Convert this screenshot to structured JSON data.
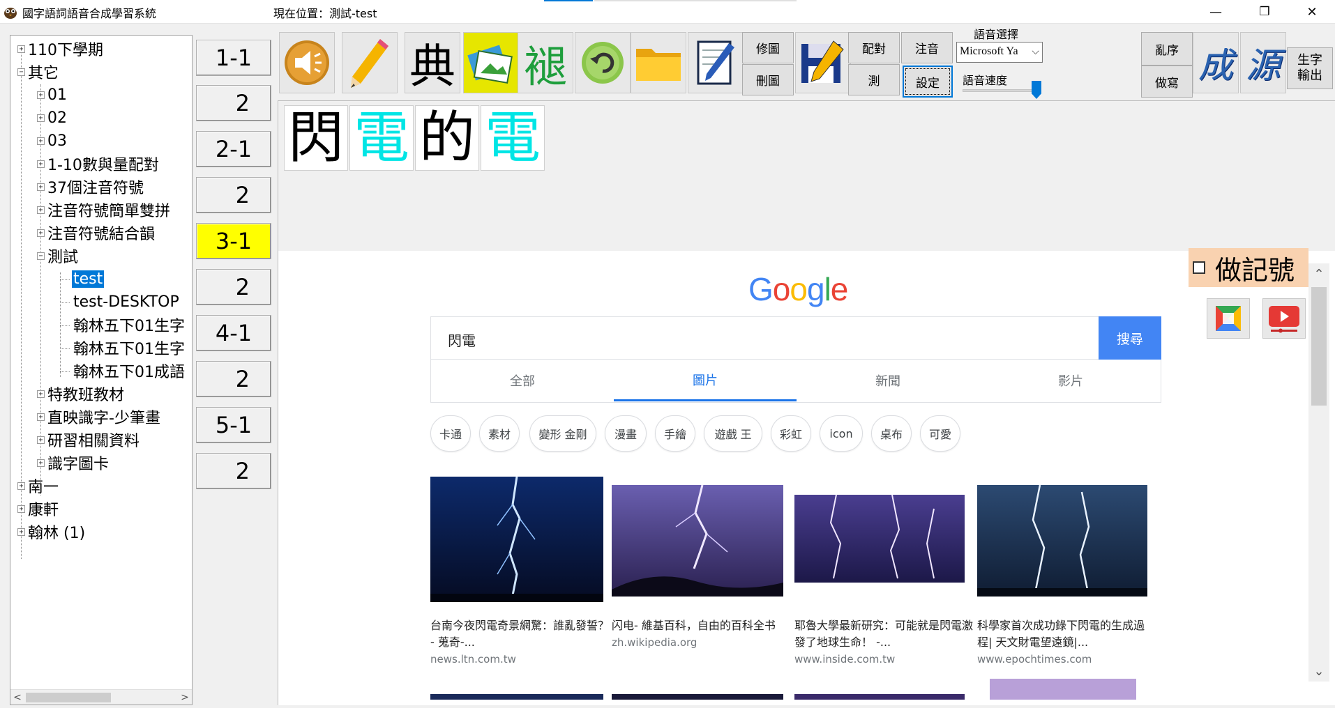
{
  "window": {
    "title": "國字語詞語音合成學習系統",
    "location": "現在位置：測試-test",
    "minimize": "—",
    "maximize": "❐",
    "close": "✕"
  },
  "tree": {
    "items": [
      {
        "label": "110下學期",
        "toggle": "+"
      },
      {
        "label": "其它",
        "toggle": "−"
      },
      {
        "label": "01",
        "toggle": "+"
      },
      {
        "label": "02",
        "toggle": "+"
      },
      {
        "label": "03",
        "toggle": "+"
      },
      {
        "label": "1-10數與量配對",
        "toggle": "+"
      },
      {
        "label": "37個注音符號",
        "toggle": "+"
      },
      {
        "label": "注音符號簡單雙拼",
        "toggle": "+"
      },
      {
        "label": "注音符號結合韻",
        "toggle": "+"
      },
      {
        "label": "測試",
        "toggle": "−"
      },
      {
        "label": "test",
        "toggle": ""
      },
      {
        "label": "test-DESKTOP",
        "toggle": ""
      },
      {
        "label": "翰林五下01生字",
        "toggle": ""
      },
      {
        "label": "翰林五下01生字",
        "toggle": ""
      },
      {
        "label": "翰林五下01成語",
        "toggle": ""
      },
      {
        "label": "特教班教材",
        "toggle": "+"
      },
      {
        "label": "直映識字-少筆畫",
        "toggle": "+"
      },
      {
        "label": "研習相關資料",
        "toggle": "+"
      },
      {
        "label": "識字圖卡",
        "toggle": "+"
      },
      {
        "label": "南一",
        "toggle": "+"
      },
      {
        "label": "康軒",
        "toggle": "+"
      },
      {
        "label": "翰林 (1)",
        "toggle": "+"
      }
    ],
    "scroll_left": "<",
    "scroll_right": ">"
  },
  "lessons": [
    "1-1",
    "2",
    "2-1",
    "2",
    "3-1",
    "2",
    "4-1",
    "2",
    "5-1",
    "2"
  ],
  "toolbar": {
    "dict_glyph": "典",
    "stroke_glyph": "褪",
    "modify_pic": "修圖",
    "delete_pic": "刪圖",
    "match": "配對",
    "test": "測",
    "zhuyin": "注音",
    "settings": "設定",
    "voice_label": "語音選擇",
    "voice_value": "Microsoft Ya",
    "speed_label": "語音速度",
    "shuffle": "亂序",
    "practice_write": "做寫",
    "idiom_glyph": "成",
    "origin_glyph": "源",
    "export_line1": "生字",
    "export_line2": "輸出"
  },
  "characters": [
    {
      "char": "閃",
      "color": "#000000"
    },
    {
      "char": "電",
      "color": "#00e5e5"
    },
    {
      "char": "的",
      "color": "#000000"
    },
    {
      "char": "電",
      "color": "#00e5e5"
    }
  ],
  "google": {
    "query": "閃電",
    "search_button": "搜尋",
    "tabs": [
      "全部",
      "圖片",
      "新聞",
      "影片"
    ],
    "active_tab": "圖片",
    "chips": [
      "卡通",
      "素材",
      "變形 金剛",
      "漫畫",
      "手繪",
      "遊戲 王",
      "彩虹",
      "icon",
      "桌布",
      "可愛"
    ],
    "results": [
      {
        "title": "台南今夜閃電奇景網驚：誰亂發誓？ - 蒐奇-...",
        "source": "news.ltn.com.tw"
      },
      {
        "title": "闪电- 維基百科，自由的百科全书",
        "source": "zh.wikipedia.org"
      },
      {
        "title": "耶魯大學最新研究：可能就是閃電激發了地球生命！ -...",
        "source": "www.inside.com.tw"
      },
      {
        "title": "科學家首次成功錄下閃電的生成過程| 天文財電望遠鏡|...",
        "source": "www.epochtimes.com"
      }
    ]
  },
  "mark": {
    "label": "做記號"
  },
  "colors": {
    "accent": "#0078d7",
    "active_lesson": "#ffff00",
    "google_blue": "#4285f4",
    "mark_bg": "#f9d2b0"
  }
}
